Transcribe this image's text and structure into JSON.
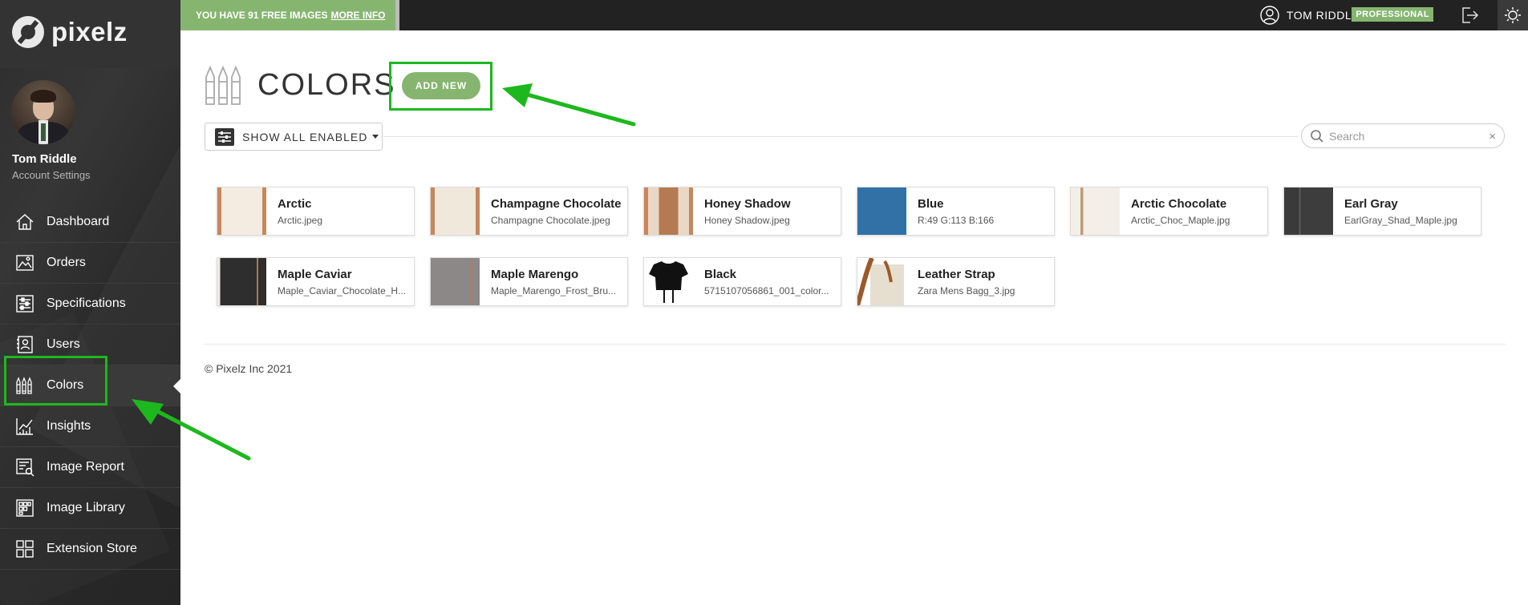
{
  "brand": {
    "name": "pixelz"
  },
  "user": {
    "name": "Tom Riddle",
    "account_settings": "Account Settings",
    "top_name": "TOM RIDDLE",
    "plan_badge": "PROFESSIONAL"
  },
  "banner": {
    "text": "YOU HAVE 91 FREE IMAGES",
    "link": "MORE INFO"
  },
  "sidebar": {
    "items": [
      {
        "label": "Dashboard",
        "icon": "house-icon"
      },
      {
        "label": "Orders",
        "icon": "image-icon"
      },
      {
        "label": "Specifications",
        "icon": "sliders-icon"
      },
      {
        "label": "Users",
        "icon": "user-card-icon"
      },
      {
        "label": "Colors",
        "icon": "crayons-icon",
        "active": true
      },
      {
        "label": "Insights",
        "icon": "chart-icon"
      },
      {
        "label": "Image Report",
        "icon": "report-icon"
      },
      {
        "label": "Image Library",
        "icon": "grid-icon"
      },
      {
        "label": "Extension Store",
        "icon": "store-icon"
      }
    ]
  },
  "page": {
    "title": "COLORS",
    "add_new": "ADD NEW",
    "filter_label": "SHOW ALL ENABLED",
    "search_placeholder": "Search",
    "search_clear": "×"
  },
  "colors": [
    {
      "name": "Arctic",
      "file": "Arctic.jpeg",
      "thumb": "wood-cream"
    },
    {
      "name": "Champagne Chocolate",
      "file": "Champagne Chocolate.jpeg",
      "thumb": "wood-cream"
    },
    {
      "name": "Honey Shadow",
      "file": "Honey Shadow.jpeg",
      "thumb": "wood-brown"
    },
    {
      "name": "Blue",
      "file": "R:49 G:113 B:166",
      "thumb": "solid",
      "color": "#3171a6"
    },
    {
      "name": "Arctic Chocolate",
      "file": "Arctic_Choc_Maple.jpg",
      "thumb": "stripe-light"
    },
    {
      "name": "Earl Gray",
      "file": "EarlGray_Shad_Maple.jpg",
      "thumb": "stripe-dark"
    },
    {
      "name": "Maple Caviar",
      "file": "Maple_Caviar_Chocolate_H...",
      "thumb": "stripe-black"
    },
    {
      "name": "Maple Marengo",
      "file": "Maple_Marengo_Frost_Bru...",
      "thumb": "stripe-gray"
    },
    {
      "name": "Black",
      "file": "5715107056861_001_color...",
      "thumb": "shirt-black"
    },
    {
      "name": "Leather Strap",
      "file": "Zara Mens Bagg_3.jpg",
      "thumb": "bag"
    }
  ],
  "footer": {
    "copyright": "© Pixelz Inc 2021"
  },
  "colors_accent": {
    "brand_green": "#86b570",
    "highlight_green": "#1db81d",
    "sidebar_bg": "#2b2b2b"
  }
}
